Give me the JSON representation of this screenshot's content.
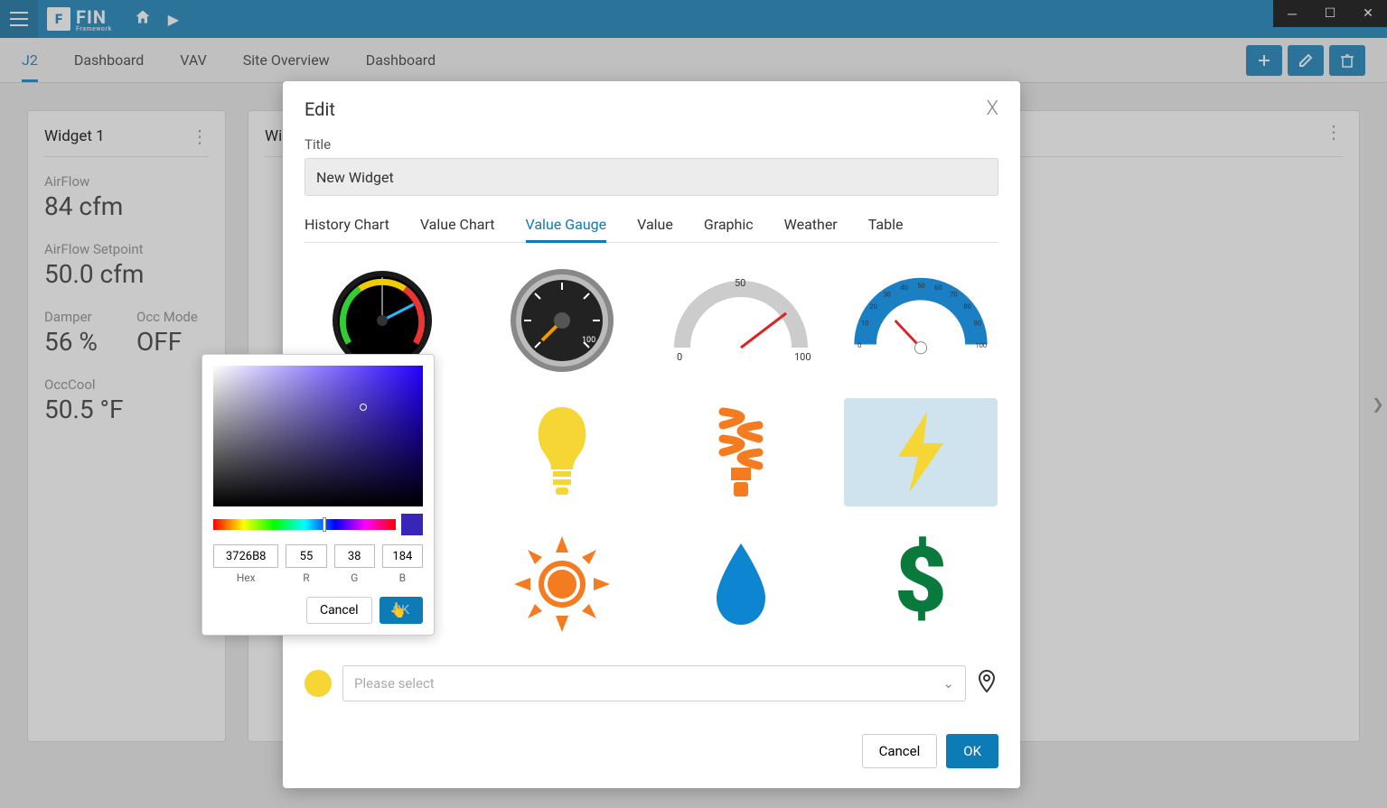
{
  "header": {
    "brand_main": "FIN",
    "brand_sub": "Framework"
  },
  "nav_tabs": {
    "t0": "J2",
    "t1": "Dashboard",
    "t2": "VAV",
    "t3": "Site Overview",
    "t4": "Dashboard"
  },
  "widget1": {
    "title": "Widget 1",
    "m0_label": "AirFlow",
    "m0_val": "84 cfm",
    "m1_label": "AirFlow Setpoint",
    "m1_val": "50.0 cfm",
    "m2_label": "Damper",
    "m2_val": "56 %",
    "m3_label": "Occ Mode",
    "m3_val": "OFF",
    "m4_label": "OccCool",
    "m4_val": "50.5 °F"
  },
  "widget2": {
    "title": "Wid"
  },
  "dialog": {
    "title": "Edit",
    "title_label": "Title",
    "title_value": "New Widget",
    "tabs": {
      "history": "History Chart",
      "valuechart": "Value Chart",
      "valuegauge": "Value Gauge",
      "value": "Value",
      "graphic": "Graphic",
      "weather": "Weather",
      "table": "Table"
    },
    "gauge_labels": {
      "semi_low": "0",
      "semi_mid": "50",
      "semi_high": "100"
    },
    "select_placeholder": "Please select",
    "cancel": "Cancel",
    "ok": "OK"
  },
  "colorpicker": {
    "hex": "3726B8",
    "r": "55",
    "g": "38",
    "b": "184",
    "hex_label": "Hex",
    "r_label": "R",
    "g_label": "G",
    "b_label": "B",
    "cancel": "Cancel",
    "ok": "OK"
  }
}
